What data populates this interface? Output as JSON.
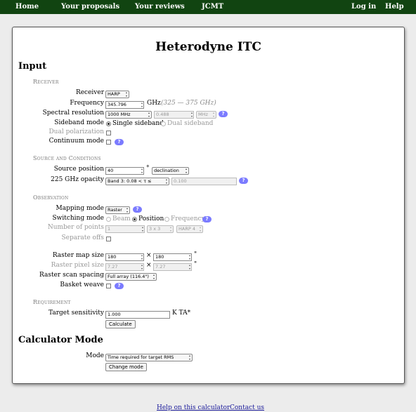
{
  "nav": {
    "home": "Home",
    "proposals": "Your proposals",
    "reviews": "Your reviews",
    "jcmt": "JCMT",
    "login": "Log in",
    "help": "Help"
  },
  "page_title": "Heterodyne ITC",
  "input_heading": "Input",
  "receiver": {
    "section": "Receiver",
    "receiver_label": "Receiver",
    "receiver_value": "HARP",
    "frequency_label": "Frequency",
    "frequency_value": "345.796",
    "frequency_unit": "GHz",
    "frequency_hint": "(325 — 375 GHz)",
    "resolution_label": "Spectral resolution",
    "resolution_value": "1000 MHz mode",
    "resolution_num": "0.488",
    "resolution_unit": "MHz",
    "sideband_label": "Sideband mode",
    "sideband_single": "Single sideband",
    "sideband_dual": "Dual sideband",
    "dualpol_label": "Dual polarization",
    "continuum_label": "Continuum mode"
  },
  "source": {
    "section": "Source and Conditions",
    "position_label": "Source position",
    "position_value": "40",
    "position_unit": "°",
    "position_type": "declination",
    "opacity_label": "225 GHz opacity",
    "opacity_value": "Band 3: 0.08 < τ ≤ 0.12",
    "opacity_num": "0.100"
  },
  "observation": {
    "section": "Observation",
    "mapping_label": "Mapping mode",
    "mapping_value": "Raster",
    "switching_label": "Switching mode",
    "sw_beam": "Beam",
    "sw_position": "Position",
    "sw_frequency": "Frequency",
    "points_label": "Number of points",
    "points_value": "1",
    "points_grid": "3 x 3",
    "points_harp": "HARP 4",
    "offs_label": "Separate offs",
    "raster_size_label": "Raster map size",
    "raster_w": "180",
    "raster_h": "180",
    "times": "×",
    "arcsec": "\"",
    "pixel_label": "Raster pixel size",
    "pixel_w": "7.27",
    "pixel_h": "7.27",
    "spacing_label": "Raster scan spacing",
    "spacing_value": "Full array (116.4\")",
    "basket_label": "Basket weave"
  },
  "requirement": {
    "section": "Requirement",
    "target_label": "Target sensitivity",
    "target_value": "1.000",
    "target_unit": "K TA*",
    "calculate": "Calculate"
  },
  "calc_heading": "Calculator Mode",
  "mode": {
    "label": "Mode",
    "value": "Time required for target RMS",
    "change": "Change mode"
  },
  "help_glyph": "?",
  "footer": {
    "help_link": "Help on this calculator",
    "contact_link": "Contact us"
  }
}
